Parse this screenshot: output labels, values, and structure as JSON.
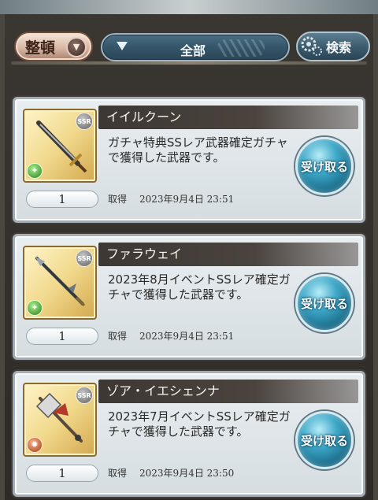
{
  "toolbar": {
    "sort_label": "整頓",
    "filter_value": "全部",
    "search_label": "検索"
  },
  "items": [
    {
      "name": "イイルクーン",
      "description": "ガチャ特典SSレア武器確定ガチャで獲得した武器です。",
      "receive_label": "受け取る",
      "quantity": "1",
      "obtained_label": "取得",
      "obtained_date": "2023年9月4日 23:51",
      "rarity": "SSR",
      "element": "wind",
      "weapon_icon": "sword-icon"
    },
    {
      "name": "ファラウェイ",
      "description": "2023年8月イベントSSレア確定ガチャで獲得した武器です。",
      "receive_label": "受け取る",
      "quantity": "1",
      "obtained_label": "取得",
      "obtained_date": "2023年9月4日 23:51",
      "rarity": "SSR",
      "element": "wind",
      "weapon_icon": "spear-icon"
    },
    {
      "name": "ゾア・イエシェンナ",
      "description": "2023年7月イベントSSレア確定ガチャで獲得した武器です。",
      "receive_label": "受け取る",
      "quantity": "1",
      "obtained_label": "取得",
      "obtained_date": "2023年9月4日 23:50",
      "rarity": "SSR",
      "element": "fire",
      "weapon_icon": "axe-icon"
    }
  ],
  "colors": {
    "accent_blue": "#3fa9c9",
    "sort_button": "#d9b8a6",
    "name_bar": "#3d3834"
  }
}
